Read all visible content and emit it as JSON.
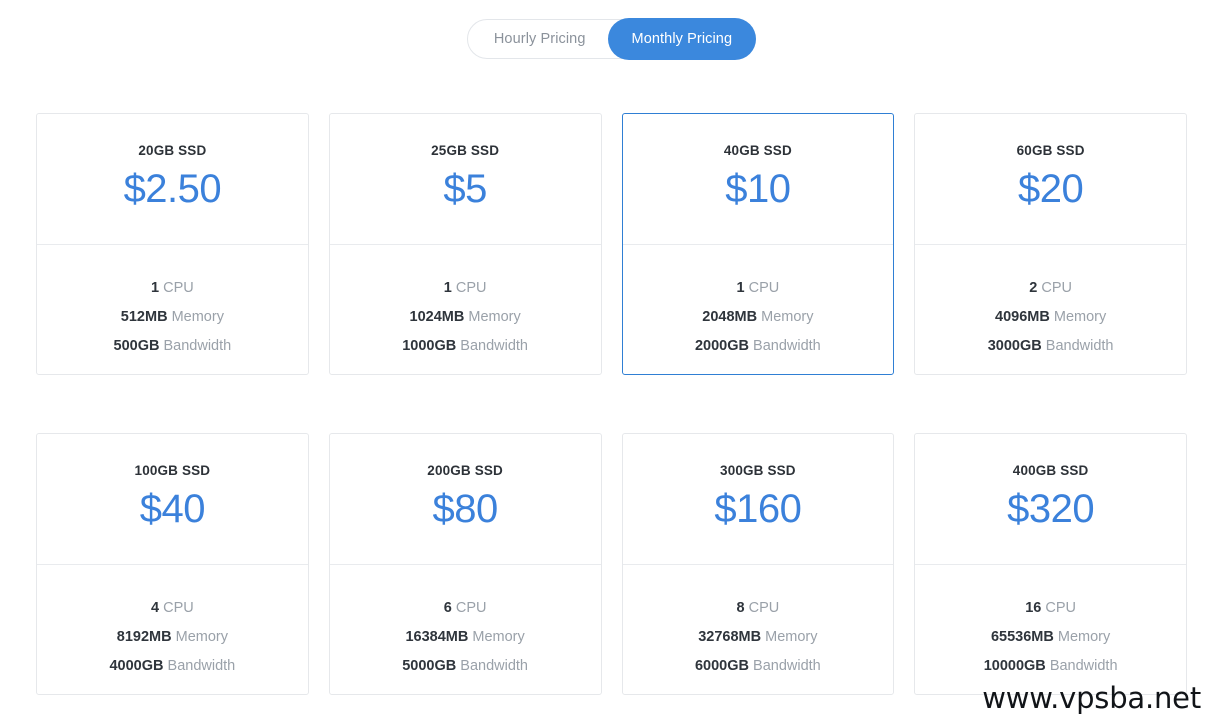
{
  "toggle": {
    "options": [
      {
        "label": "Hourly Pricing",
        "active": false
      },
      {
        "label": "Monthly Pricing",
        "active": true
      }
    ]
  },
  "colors": {
    "accent_blue": "#3b88dd",
    "price_blue": "#3b81db",
    "selected_border": "#2f7fd4",
    "card_border": "#e6e8eb",
    "value_text": "#2f353c",
    "label_text": "#9aa1a9"
  },
  "spec_labels": {
    "cpu": "CPU",
    "memory": "Memory",
    "bandwidth": "Bandwidth"
  },
  "plans": [
    {
      "title": "20GB SSD",
      "price": "$2.50",
      "cpu": "1",
      "memory": "512MB",
      "bandwidth": "500GB",
      "selected": false
    },
    {
      "title": "25GB SSD",
      "price": "$5",
      "cpu": "1",
      "memory": "1024MB",
      "bandwidth": "1000GB",
      "selected": false
    },
    {
      "title": "40GB SSD",
      "price": "$10",
      "cpu": "1",
      "memory": "2048MB",
      "bandwidth": "2000GB",
      "selected": true
    },
    {
      "title": "60GB SSD",
      "price": "$20",
      "cpu": "2",
      "memory": "4096MB",
      "bandwidth": "3000GB",
      "selected": false
    },
    {
      "title": "100GB SSD",
      "price": "$40",
      "cpu": "4",
      "memory": "8192MB",
      "bandwidth": "4000GB",
      "selected": false
    },
    {
      "title": "200GB SSD",
      "price": "$80",
      "cpu": "6",
      "memory": "16384MB",
      "bandwidth": "5000GB",
      "selected": false
    },
    {
      "title": "300GB SSD",
      "price": "$160",
      "cpu": "8",
      "memory": "32768MB",
      "bandwidth": "6000GB",
      "selected": false
    },
    {
      "title": "400GB SSD",
      "price": "$320",
      "cpu": "16",
      "memory": "65536MB",
      "bandwidth": "10000GB",
      "selected": false
    }
  ],
  "watermark": "www.vpsba.net"
}
